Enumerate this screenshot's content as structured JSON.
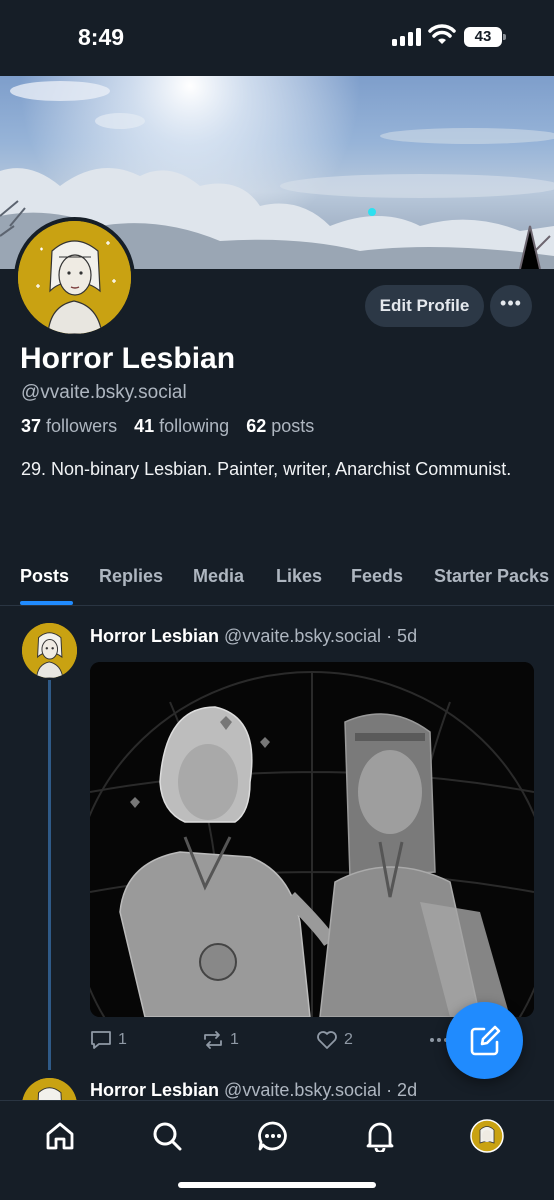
{
  "status_bar": {
    "time": "8:49",
    "battery": "43"
  },
  "profile": {
    "display_name": "Horror Lesbian",
    "handle": "@vvaite.bsky.social",
    "followers_count": "37",
    "followers_label": "followers",
    "following_count": "41",
    "following_label": "following",
    "posts_count": "62",
    "posts_label": "posts",
    "bio": "29. Non-binary Lesbian. Painter, writer, Anarchist Communist.",
    "edit_label": "Edit Profile",
    "more_label": "•••"
  },
  "tabs": [
    {
      "label": "Posts",
      "active": true
    },
    {
      "label": "Replies"
    },
    {
      "label": "Media"
    },
    {
      "label": "Likes"
    },
    {
      "label": "Feeds"
    },
    {
      "label": "Starter Packs"
    }
  ],
  "posts": [
    {
      "author": "Horror Lesbian",
      "handle": "@vvaite.bsky.social",
      "age": "· 5d",
      "replies": "1",
      "reposts": "1",
      "likes": "2"
    },
    {
      "author": "Horror Lesbian",
      "handle": "@vvaite.bsky.social",
      "age": "· 2d"
    }
  ],
  "icons": {
    "home": "home-icon",
    "search": "search-icon",
    "chat": "chat-icon",
    "notifications": "bell-icon",
    "compose": "compose-icon"
  },
  "colors": {
    "accent": "#208bfe",
    "background": "#161e27",
    "avatar_bg": "#c9a212"
  }
}
